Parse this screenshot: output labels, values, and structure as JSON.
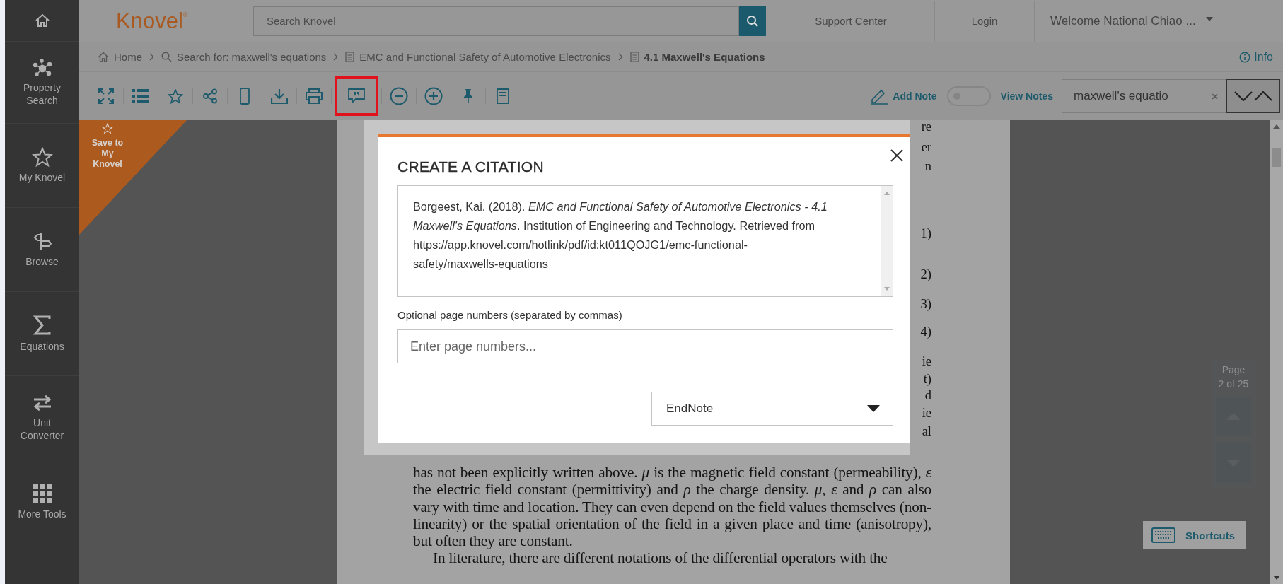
{
  "sidebar": {
    "items": [
      {
        "label": "Property Search"
      },
      {
        "label": "My Knovel"
      },
      {
        "label": "Browse"
      },
      {
        "label": "Equations"
      },
      {
        "label": "Unit Converter"
      },
      {
        "label": "More Tools"
      }
    ]
  },
  "header": {
    "logo": "Knovel$^{®}$",
    "search": {
      "placeholder": "Search Knovel"
    },
    "links": [
      "Support Center",
      "Login"
    ],
    "account": "Welcome National Chiao ..."
  },
  "breadcrumb": {
    "items": [
      {
        "label": "Home",
        "kind": "home",
        "current": false
      },
      {
        "label": "Search for:  maxwell's equations",
        "kind": "search",
        "current": false
      },
      {
        "label": "EMC and Functional Safety of Automotive Electronics",
        "kind": "document",
        "current": false
      },
      {
        "label": "4.1 Maxwell's Equations",
        "kind": "document",
        "current": true
      }
    ],
    "info": "Info"
  },
  "toolbar": {
    "tools": [
      {
        "highlighted": false
      },
      {
        "highlighted": false
      },
      {
        "highlighted": false
      },
      {
        "highlighted": false
      },
      {
        "highlighted": false
      },
      {
        "highlighted": false
      },
      {
        "highlighted": false
      },
      {
        "highlighted": true
      },
      {
        "highlighted": false
      },
      {
        "highlighted": false
      },
      {
        "highlighted": false
      },
      {
        "highlighted": false
      }
    ],
    "add_note": "Add Note",
    "notes_toggle": {
      "on": false
    },
    "view_notes": "View Notes",
    "find": {
      "value": "maxwell's equatio"
    }
  },
  "save_banner": "Save to My Knovel",
  "document": {
    "fragments": [
      "re",
      "er",
      "n",
      "1)",
      "2)",
      "3)",
      "4)",
      "ie",
      "t)",
      "d",
      "ie",
      "al"
    ],
    "paragraphs": [
      {
        "text": "has not been explicitly written above. *μ* is the magnetic field constant (permeability), *ε* the electric field constant (permittivity) and *ρ* the charge density. *μ*, *ε* and *ρ* can also vary with time and location. They can even depend on the field values themselves (non-linearity) or the spatial orientation of the field in a given place and time (anisotropy), but often they are constant.",
        "indent": false
      },
      {
        "text": "In literature, there are different notations of the differential operators with the",
        "indent": true
      }
    ]
  },
  "dialog": {
    "title": "CREATE A CITATION",
    "citation": "Borgeest, Kai. (2018). *EMC and Functional Safety of Automotive Electronics - 4.1 Maxwell's Equations*. Institution of Engineering and Technology. Retrieved from https://app.knovel.com/hotlink/pdf/id:kt011QOJG1/emc-functional-safety/maxwells-equations",
    "pages": {
      "label": "Optional page numbers (separated by commas)",
      "placeholder": "Enter page numbers..."
    },
    "format": "EndNote"
  },
  "page_nav": {
    "label": "Page",
    "count": "2 of 25"
  },
  "shortcuts": "Shortcuts"
}
